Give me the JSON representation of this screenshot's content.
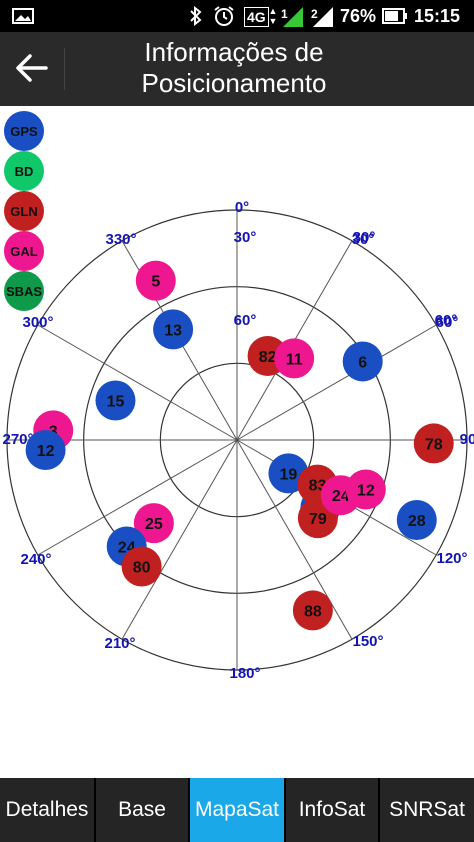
{
  "status_bar": {
    "battery_percent": "76%",
    "time": "15:15",
    "network_label": "4G",
    "sim1": "1",
    "sim2": "2",
    "icons": [
      "image-icon",
      "bluetooth-icon",
      "alarm-icon",
      "signal-icon",
      "battery-icon"
    ]
  },
  "app_bar": {
    "title_line1": "Informações de",
    "title_line2": "Posicionamento",
    "back_icon": "arrow-left-icon"
  },
  "legend": [
    {
      "label": "GPS",
      "color": "#1a4fc4"
    },
    {
      "label": "BD",
      "color": "#10c86a"
    },
    {
      "label": "GLN",
      "color": "#c0201f"
    },
    {
      "label": "GAL",
      "color": "#ee1790"
    },
    {
      "label": "SBAS",
      "color": "#0e9a4a"
    }
  ],
  "sky_plot": {
    "azimuth_labels": [
      "0°",
      "30°",
      "60°",
      "90",
      "120°",
      "150°",
      "180°",
      "210°",
      "240°",
      "270°",
      "300°",
      "330°"
    ],
    "elevation_labels": [
      "30°",
      "60°"
    ],
    "satellites": [
      {
        "id": "5",
        "system": "GAL",
        "az": 333,
        "el": 20
      },
      {
        "id": "13",
        "system": "GPS",
        "az": 330,
        "el": 40
      },
      {
        "id": "82",
        "system": "GLN",
        "az": 20,
        "el": 55
      },
      {
        "id": "11",
        "system": "GAL",
        "az": 35,
        "el": 51
      },
      {
        "id": "6",
        "system": "GPS",
        "az": 58,
        "el": 32
      },
      {
        "id": "15",
        "system": "GPS",
        "az": 288,
        "el": 40
      },
      {
        "id": "3",
        "system": "GAL",
        "az": 273,
        "el": 18
      },
      {
        "id": "12",
        "system": "GPS",
        "az": 267,
        "el": 15
      },
      {
        "id": "78",
        "system": "GLN",
        "az": 91,
        "el": 13
      },
      {
        "id": "19",
        "system": "GPS",
        "az": 123,
        "el": 66
      },
      {
        "id": "8",
        "system": "GPS",
        "az": 129,
        "el": 48
      },
      {
        "id": "83",
        "system": "GLN",
        "az": 119,
        "el": 54
      },
      {
        "id": "79",
        "system": "GLN",
        "az": 134,
        "el": 46
      },
      {
        "id": "24",
        "system": "GAL",
        "az": 118,
        "el": 44
      },
      {
        "id": "12",
        "system": "GAL",
        "az": 111,
        "el": 36
      },
      {
        "id": "28",
        "system": "GPS",
        "az": 114,
        "el": 13
      },
      {
        "id": "25",
        "system": "GAL",
        "az": 225,
        "el": 44
      },
      {
        "id": "24",
        "system": "GPS",
        "az": 226,
        "el": 30
      },
      {
        "id": "80",
        "system": "GLN",
        "az": 217,
        "el": 28
      },
      {
        "id": "88",
        "system": "GLN",
        "az": 156,
        "el": 17
      }
    ]
  },
  "bottom_nav": [
    {
      "label": "Detalhes",
      "active": false
    },
    {
      "label": "Base",
      "active": false
    },
    {
      "label": "MapaSat",
      "active": true
    },
    {
      "label": "InfoSat",
      "active": false
    },
    {
      "label": "SNRSat",
      "active": false
    }
  ]
}
